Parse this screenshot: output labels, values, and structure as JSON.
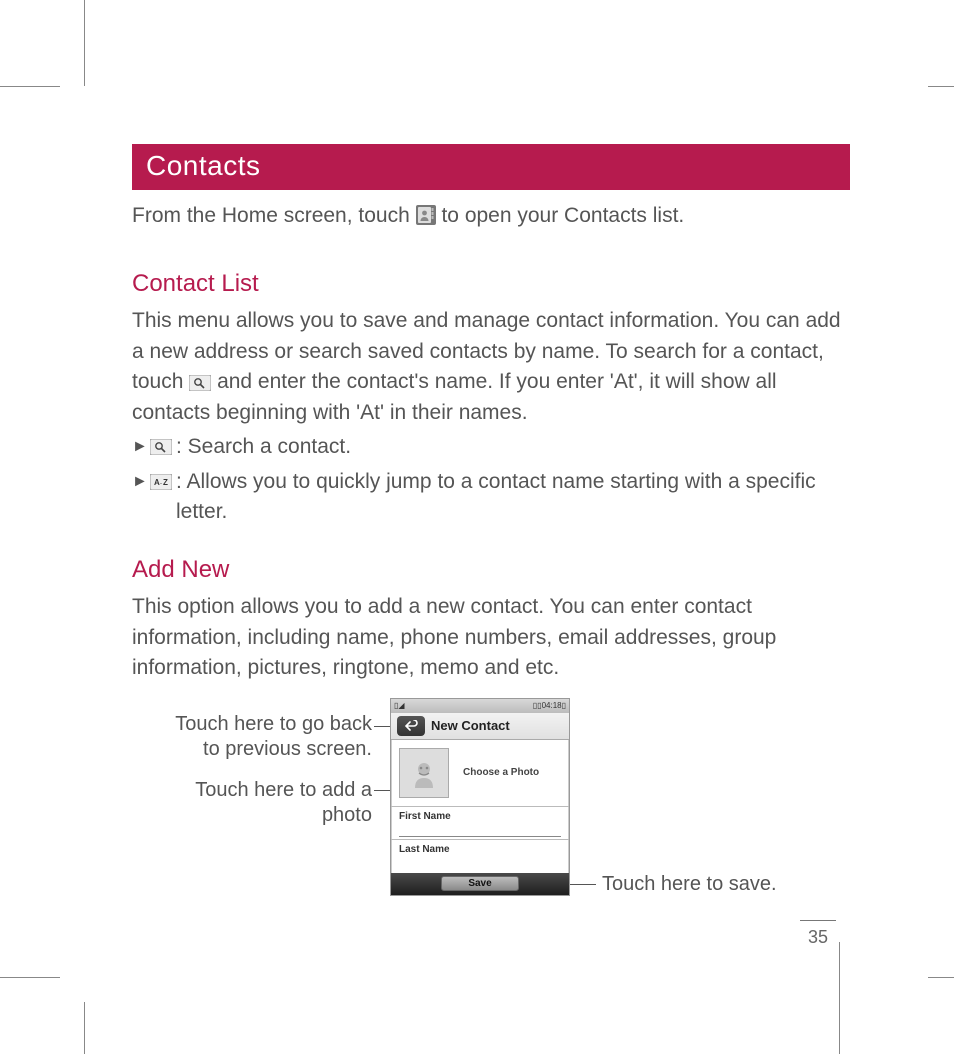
{
  "page_number": "35",
  "title": "Contacts",
  "intro_before_icon": "From the Home screen, touch",
  "intro_after_icon": "to open your Contacts list.",
  "sections": {
    "contact_list": {
      "heading": "Contact List",
      "body_before_icon": "This menu allows you to save and manage contact information. You can add a new address or search saved contacts by name. To search for a contact, touch",
      "body_after_icon": "and enter the contact's name. If you enter 'At', it will show all contacts beginning with 'At' in their names.",
      "bullets": [
        {
          "icon": "search",
          "text": ": Search a contact."
        },
        {
          "icon": "az",
          "text": ": Allows you to quickly jump to a contact name starting with a specific letter."
        }
      ]
    },
    "add_new": {
      "heading": "Add New",
      "body": "This option allows you to add a new contact. You can enter contact information, including name, phone numbers, email addresses, group information, pictures, ringtone, memo and etc."
    }
  },
  "phone": {
    "status_left": "▯◢",
    "status_right": "▯▯04:18▯",
    "header_title": "New Contact",
    "choose_photo": "Choose a Photo",
    "first_name": "First Name",
    "last_name": "Last Name",
    "save": "Save"
  },
  "callouts": {
    "back_l1": "Touch here to go back",
    "back_l2": "to previous screen.",
    "photo_l1": "Touch here to add a",
    "photo_l2": "photo",
    "save": "Touch here to save."
  }
}
